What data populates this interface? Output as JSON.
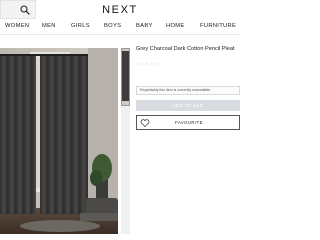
{
  "header": {
    "logo": "NEXT",
    "search_icon": "search-icon"
  },
  "nav": {
    "items": [
      "WOMEN",
      "MEN",
      "GIRLS",
      "BOYS",
      "BABY",
      "HOME",
      "FURNITURE"
    ]
  },
  "product": {
    "title": "Grey Charcoal Dark Cotton Pencil Pleat",
    "rating_stars": "☆☆☆☆☆",
    "unavailable_msg": "Regrettably this item is currently unavailable.",
    "add_to_bag_label": "ADD TO BAG",
    "favourite_label": "FAVOURITE",
    "favourite_icon": "heart-icon"
  },
  "colors": {
    "accent_disabled": "#d8dce0",
    "curtain": "#3c3b3a"
  }
}
